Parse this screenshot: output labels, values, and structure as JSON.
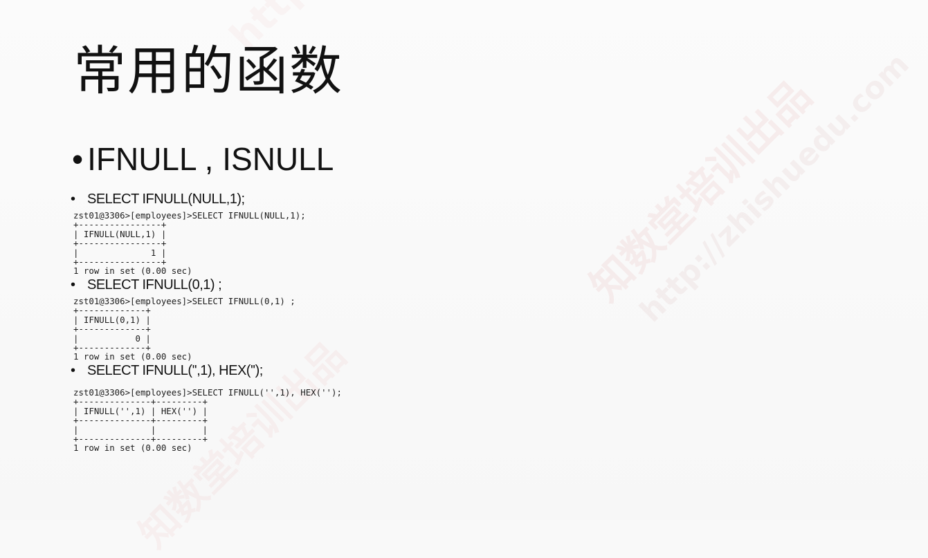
{
  "title": "常用的函数",
  "main_bullet": {
    "marker": "•",
    "text": "IFNULL , ISNULL"
  },
  "examples": [
    {
      "marker": "•",
      "heading": "SELECT IFNULL(NULL,1);",
      "output": "zst01@3306>[employees]>SELECT IFNULL(NULL,1);\n+----------------+\n| IFNULL(NULL,1) |\n+----------------+\n|              1 |\n+----------------+\n1 row in set (0.00 sec)"
    },
    {
      "marker": "•",
      "heading": "SELECT IFNULL(0,1) ;",
      "output": "zst01@3306>[employees]>SELECT IFNULL(0,1) ;\n+-------------+\n| IFNULL(0,1) |\n+-------------+\n|           0 |\n+-------------+\n1 row in set (0.00 sec)"
    },
    {
      "marker": "•",
      "heading": "SELECT IFNULL('',1), HEX('');",
      "output": "zst01@3306>[employees]>SELECT IFNULL('',1), HEX('');\n+--------------+---------+\n| IFNULL('',1) | HEX('') |\n+--------------+---------+\n|              |         |\n+--------------+---------+\n1 row in set (0.00 sec)"
    }
  ],
  "watermark": {
    "line1": "知数堂培训出品",
    "line2": "http://zhishuedu.com"
  }
}
